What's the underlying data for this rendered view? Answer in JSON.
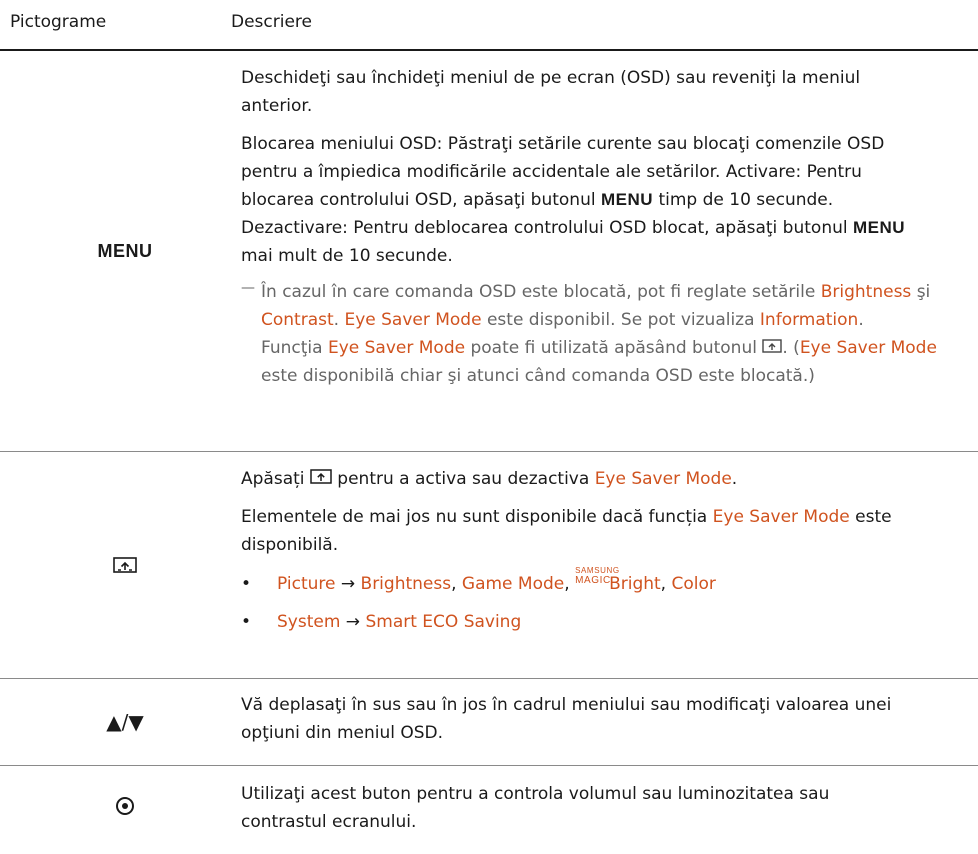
{
  "header": {
    "col1": "Pictograme",
    "col2": "Descriere"
  },
  "row_menu": {
    "icon_label": "MENU",
    "p1": "Deschideţi sau închideţi meniul de pe ecran (OSD) sau reveniţi la meniul",
    "p1b": "anterior.",
    "p2a": "Blocarea meniului OSD: Păstraţi setările curente sau blocaţi comenzile OSD",
    "p2b": "pentru a împiedica modificările accidentale ale setărilor. Activare: Pentru",
    "p2c_pre": "blocarea controlului OSD, apăsaţi butonul ",
    "p2c_menu": "MENU",
    "p2c_post": " timp de 10 secunde.",
    "p2d_pre": "Dezactivare: Pentru deblocarea controlului OSD blocat, apăsaţi butonul ",
    "p2d_menu": "MENU",
    "p2e": "mai mult de 10 secunde.",
    "note": {
      "l1_pre": "În cazul în care comanda OSD este blocată, pot fi reglate setările ",
      "brightness": "Brightness",
      "l1_post": " şi",
      "contrast": "Contrast",
      "l2_mid": ". ",
      "eye_saver": "Eye Saver Mode",
      "l2_post": " este disponibil. Se pot vizualiza ",
      "information": "Information",
      "l2_end": ".",
      "l3_pre": "Funcţia ",
      "l3_mid": " poate fi utilizată apăsând butonul ",
      "l3_post": ". (",
      "l4": "este disponibilă chiar şi atunci când comanda OSD este blocată.)"
    }
  },
  "row_eye": {
    "l1_pre": "Apăsați ",
    "l1_mid": " pentru a activa sau dezactiva ",
    "eye_saver": "Eye Saver Mode",
    "l1_end": ".",
    "l2_pre": "Elementele de mai jos nu sunt disponibile dacă funcția ",
    "l2_post": " este",
    "l3": "disponibilă.",
    "bullet1": {
      "picture": "Picture",
      "arrow": " → ",
      "brightness": "Brightness",
      "sep": ", ",
      "game_mode": "Game Mode",
      "magic_top": "SAMSUNG",
      "magic_bottom": "MAGIC",
      "bright": "Bright",
      "color": "Color"
    },
    "bullet2": {
      "system": "System",
      "arrow": " → ",
      "smart_eco": "Smart ECO Saving"
    }
  },
  "row_arrows": {
    "icon_text": "▲/▼",
    "l1": "Vă deplasaţi în sus sau în jos în cadrul meniului sau modificaţi valoarea unei",
    "l2": "opţiuni din meniul OSD."
  },
  "row_jog": {
    "l1": "Utilizaţi acest buton pentru a controla volumul sau luminozitatea sau",
    "l2": "contrastul ecranului."
  },
  "colors": {
    "accent": "#d0531f",
    "note_gray": "#666666",
    "text": "#1a1a1a"
  }
}
